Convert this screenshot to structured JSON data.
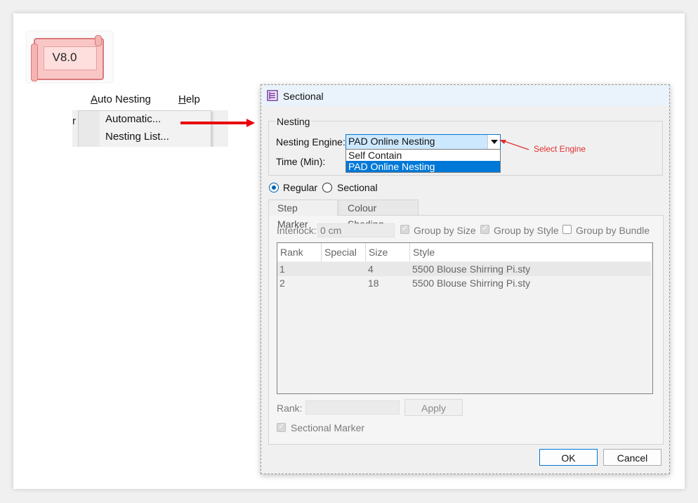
{
  "version_badge": {
    "text": "V8.0"
  },
  "menu": {
    "bar_items": [
      {
        "accel": "A",
        "rest": "uto Nesting"
      },
      {
        "accel": "H",
        "rest": "elp"
      }
    ],
    "edge_char": "r",
    "dropdown_items": [
      "Automatic...",
      "Nesting List..."
    ]
  },
  "dialog": {
    "title": "Sectional",
    "nesting_group": {
      "legend": "Nesting",
      "engine_label": "Nesting Engine:",
      "engine_value": "PAD Online Nesting",
      "engine_options": [
        "Self Contain",
        "PAD Online Nesting"
      ],
      "selected_option_index": 1,
      "time_label": "Time (Min):"
    },
    "callout": {
      "text": "Select Engine",
      "color": "#e03030"
    },
    "mode_options": [
      {
        "label": "Regular",
        "checked": true
      },
      {
        "label": "Sectional",
        "checked": false
      }
    ],
    "tabs": [
      {
        "label": "Step Marker",
        "active": true
      },
      {
        "label": "Colour Shading",
        "active": false
      }
    ],
    "interlock": {
      "label": "Interlock:",
      "value": "0 cm"
    },
    "checkboxes": [
      {
        "label": "Group by Size",
        "checked": true,
        "disabled": true
      },
      {
        "label": "Group by Style",
        "checked": true,
        "disabled": true
      },
      {
        "label": "Group by Bundle",
        "checked": false,
        "disabled": false
      }
    ],
    "table": {
      "columns": [
        "Rank",
        "Special",
        "Size",
        "Style"
      ],
      "rows": [
        {
          "rank": "1",
          "special": "",
          "size": "4",
          "style": "5500 Blouse Shirring Pi.sty"
        },
        {
          "rank": "2",
          "special": "",
          "size": "18",
          "style": "5500 Blouse Shirring Pi.sty"
        }
      ]
    },
    "rank_label": "Rank:",
    "rank_value": "",
    "apply_label": "Apply",
    "sectional_marker": {
      "label": "Sectional Marker",
      "checked": true
    },
    "ok_label": "OK",
    "cancel_label": "Cancel"
  },
  "colors": {
    "accent": "#0078d7",
    "arrow_red": "#e8000d",
    "badge_pink": "#f9c6c6"
  }
}
